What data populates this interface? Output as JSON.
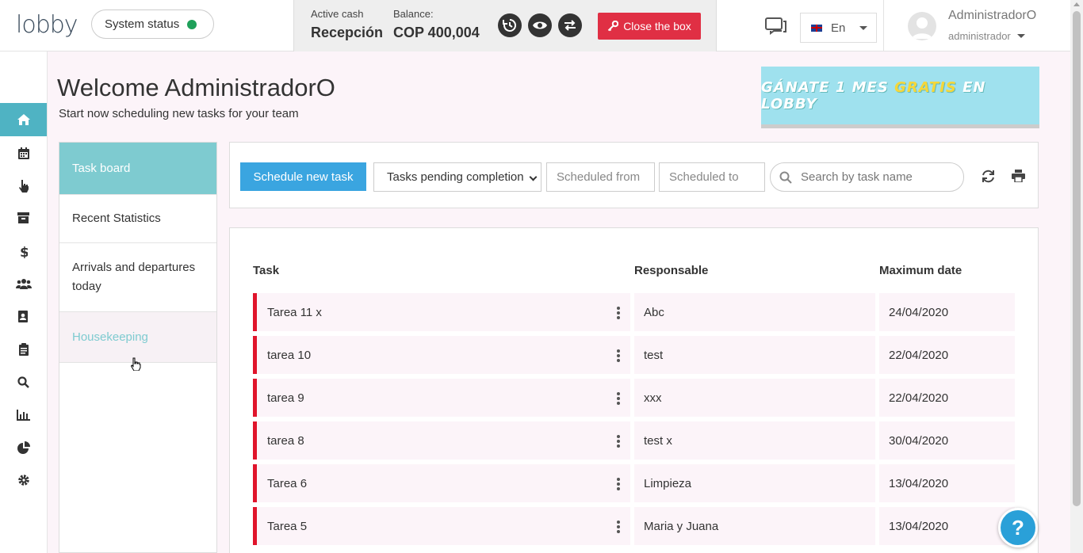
{
  "header": {
    "logo": "lobby",
    "system_status_label": "System status",
    "active_cash_label": "Active cash",
    "active_cash_value": "Recepción",
    "balance_label": "Balance:",
    "balance_value": "COP 400,004",
    "close_box_label": "Close the box",
    "language": "En",
    "user_name": "AdministradorO",
    "user_role": "administrador"
  },
  "colors": {
    "accent": "#4fb3c3",
    "primary": "#3aa5e0",
    "danger": "#e02f44",
    "status_ok": "#1fa05a"
  },
  "sidebar": {
    "icons": [
      "home-icon",
      "calendar-icon",
      "hand-pointer-icon",
      "archive-icon",
      "dollar-icon",
      "users-icon",
      "contacts-icon",
      "clipboard-icon",
      "search-icon",
      "bar-chart-icon",
      "pie-chart-icon",
      "gear-icon"
    ]
  },
  "main": {
    "welcome": "Welcome AdministradorO",
    "subtitle": "Start now scheduling new tasks for your team",
    "banner_pre": "GÁNATE 1 MES ",
    "banner_mid": "GRATIS",
    "banner_post": " EN LOBBY"
  },
  "tabs": [
    {
      "label": "Task board"
    },
    {
      "label": "Recent Statistics"
    },
    {
      "label": "Arrivals and departures today"
    },
    {
      "label": "Housekeeping"
    }
  ],
  "toolbar": {
    "schedule_label": "Schedule new task",
    "filter_value": "Tasks pending completion",
    "scheduled_from": "Scheduled from",
    "scheduled_to": "Scheduled to",
    "search_placeholder": "Search by task name"
  },
  "table": {
    "headers": {
      "task": "Task",
      "responsable": "Responsable",
      "max_date": "Maximum date"
    },
    "rows": [
      {
        "task": "Tarea 11 x",
        "responsable": "Abc",
        "date": "24/04/2020"
      },
      {
        "task": "tarea 10",
        "responsable": "test",
        "date": "22/04/2020"
      },
      {
        "task": "tarea 9",
        "responsable": "xxx",
        "date": "22/04/2020"
      },
      {
        "task": "tarea 8",
        "responsable": "test x",
        "date": "30/04/2020"
      },
      {
        "task": "Tarea 6",
        "responsable": "Limpieza",
        "date": "13/04/2020"
      },
      {
        "task": "Tarea 5",
        "responsable": "Maria y Juana",
        "date": "13/04/2020"
      }
    ]
  },
  "help_label": "?"
}
